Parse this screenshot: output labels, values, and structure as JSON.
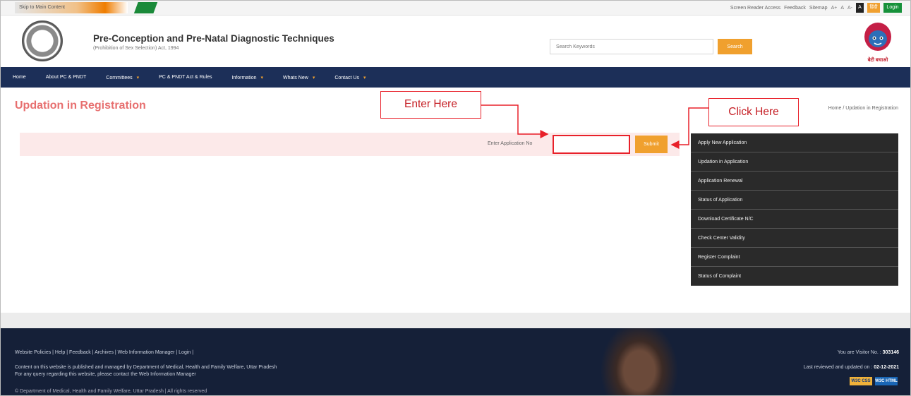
{
  "topbar": {
    "skip_label": "Skip to Main Content",
    "links": [
      "Screen Reader Access",
      "Feedback",
      "Sitemap"
    ],
    "font_sizes": [
      "A+",
      "A",
      "A-"
    ],
    "contrast_label": "A",
    "lang_label": "हिंदी",
    "login_label": "Login"
  },
  "header": {
    "title": "Pre-Conception and Pre-Natal Diagnostic Techniques",
    "subtitle": "(Prohibition of Sex Selection) Act, 1994",
    "search_placeholder": "Search Keywords",
    "search_button": "Search",
    "mascot_caption": "बेटी बचाओ"
  },
  "nav": {
    "items": [
      {
        "label": "Home",
        "caret": false
      },
      {
        "label": "About PC & PNDT",
        "caret": false
      },
      {
        "label": "Committees",
        "caret": true
      },
      {
        "label": "PC & PNDT Act & Rules",
        "caret": false
      },
      {
        "label": "Information",
        "caret": true
      },
      {
        "label": "Whats New",
        "caret": true
      },
      {
        "label": "Contact Us",
        "caret": true
      }
    ]
  },
  "main": {
    "page_title": "Updation in Registration",
    "breadcrumb": "Home / Updation in Registration",
    "app_label": "Enter Application No",
    "app_value": "",
    "submit_label": "Submit"
  },
  "side_menu": {
    "items": [
      "Apply New Application",
      "Updation in Application",
      "Application Renewal",
      "Status of Application",
      "Download Certificate N/C",
      "Check Center Validity",
      "Register Complaint",
      "Status of Complaint"
    ]
  },
  "annotations": {
    "enter_here": "Enter Here",
    "click_here": "Click Here",
    "color": "#e8212a"
  },
  "footer": {
    "links": "Website Policies | Help | Feedback | Archives | Web Information Manager | Login |",
    "text1": "Content on this website is published and managed by Department of Medical, Health and Family Welfare, Uttar Pradesh",
    "text2": "For any query regarding this website, please contact the Web Information Manager",
    "copyright": "© Department of Medical, Health and Family Welfare, Uttar Pradesh | All rights reserved",
    "visitor_label": "You are Visitor No. :",
    "visitor_number": "303146",
    "updated_label": "Last reviewed and updated on :",
    "updated_date": "02-12-2021",
    "badge_css": "W3C CSS",
    "badge_html": "W3C HTML"
  },
  "colors": {
    "nav_bg": "#1c2f58",
    "accent_orange": "#f0a02e",
    "title_red": "#e76f6f",
    "footer_bg": "#152038",
    "side_menu_bg": "#2a2a2a"
  }
}
